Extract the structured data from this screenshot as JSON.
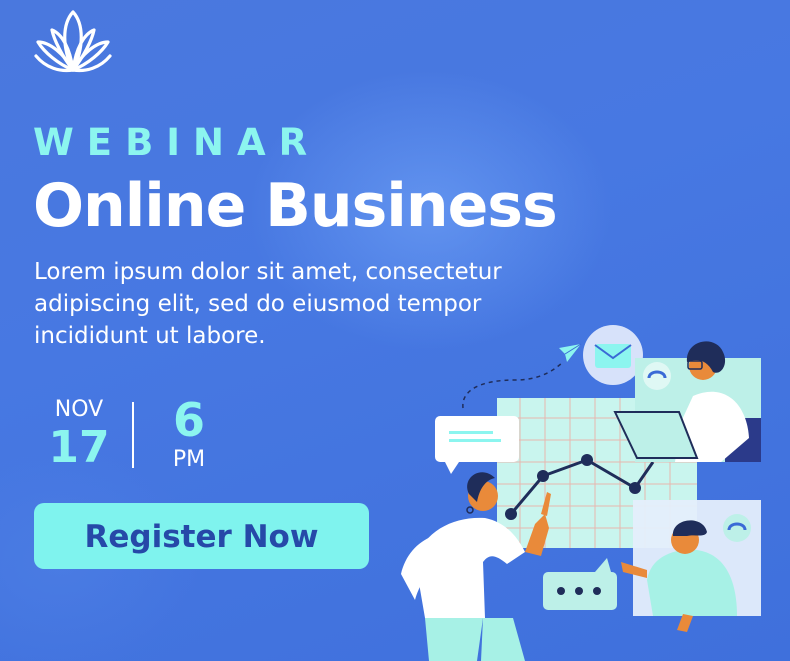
{
  "eyebrow": "WEBINAR",
  "title": "Online Business",
  "description": "Lorem ipsum dolor sit amet, consectetur adipiscing elit, sed do eiusmod tempor incididunt ut labore.",
  "date": {
    "month": "NOV",
    "day": "17"
  },
  "time": {
    "hour": "6",
    "period": "PM"
  },
  "cta": {
    "label": "Register Now"
  },
  "icons": [
    "lotus-logo-icon",
    "paper-plane-icon",
    "envelope-icon",
    "phone-icon",
    "chat-bubble-icon",
    "typing-dots-icon"
  ],
  "colors": {
    "background": "#4778e2",
    "accent": "#8cf5ef",
    "button": "#7ff3ee",
    "button_text": "#2649a8"
  }
}
